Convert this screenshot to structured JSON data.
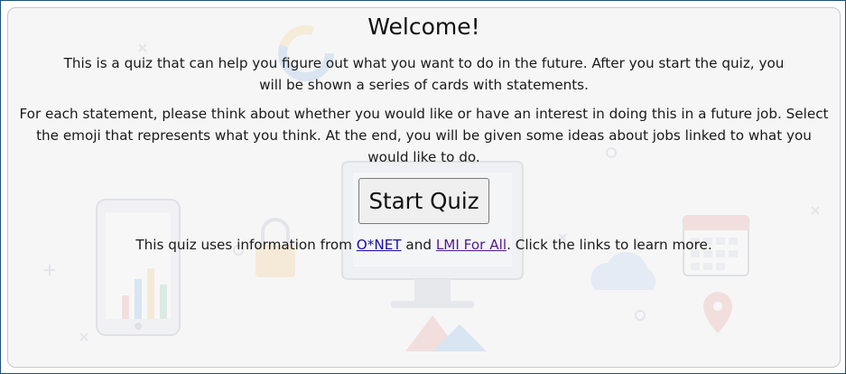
{
  "card": {
    "title": "Welcome!",
    "intro": "This is a quiz that can help you figure out what you want to do in the future. After you start the quiz, you will be shown a series of cards with statements.",
    "instructions": "For each statement, please think about whether you would like or have an interest in doing this in a future job. Select the emoji that represents what you think. At the end, you will be given some ideas about jobs linked to what you would like to do.",
    "start_button_label": "Start Quiz"
  },
  "footer": {
    "prefix": "This quiz uses information from ",
    "link1_label": "O*NET",
    "middle": " and ",
    "link2_label": "LMI For All",
    "suffix": ". Click the links to learn more."
  },
  "colors": {
    "frame_border": "#1f4e79",
    "card_background": "#f6f6f7",
    "link": "#1a0dab",
    "visited_link": "#551a8b"
  },
  "background_decorations": [
    "tablet-illustration",
    "bar-chart-illustration",
    "padlock-icon",
    "monitor-illustration",
    "calendar-icon",
    "cloud-icon",
    "map-pin-icon",
    "donut-chart-illustration"
  ]
}
